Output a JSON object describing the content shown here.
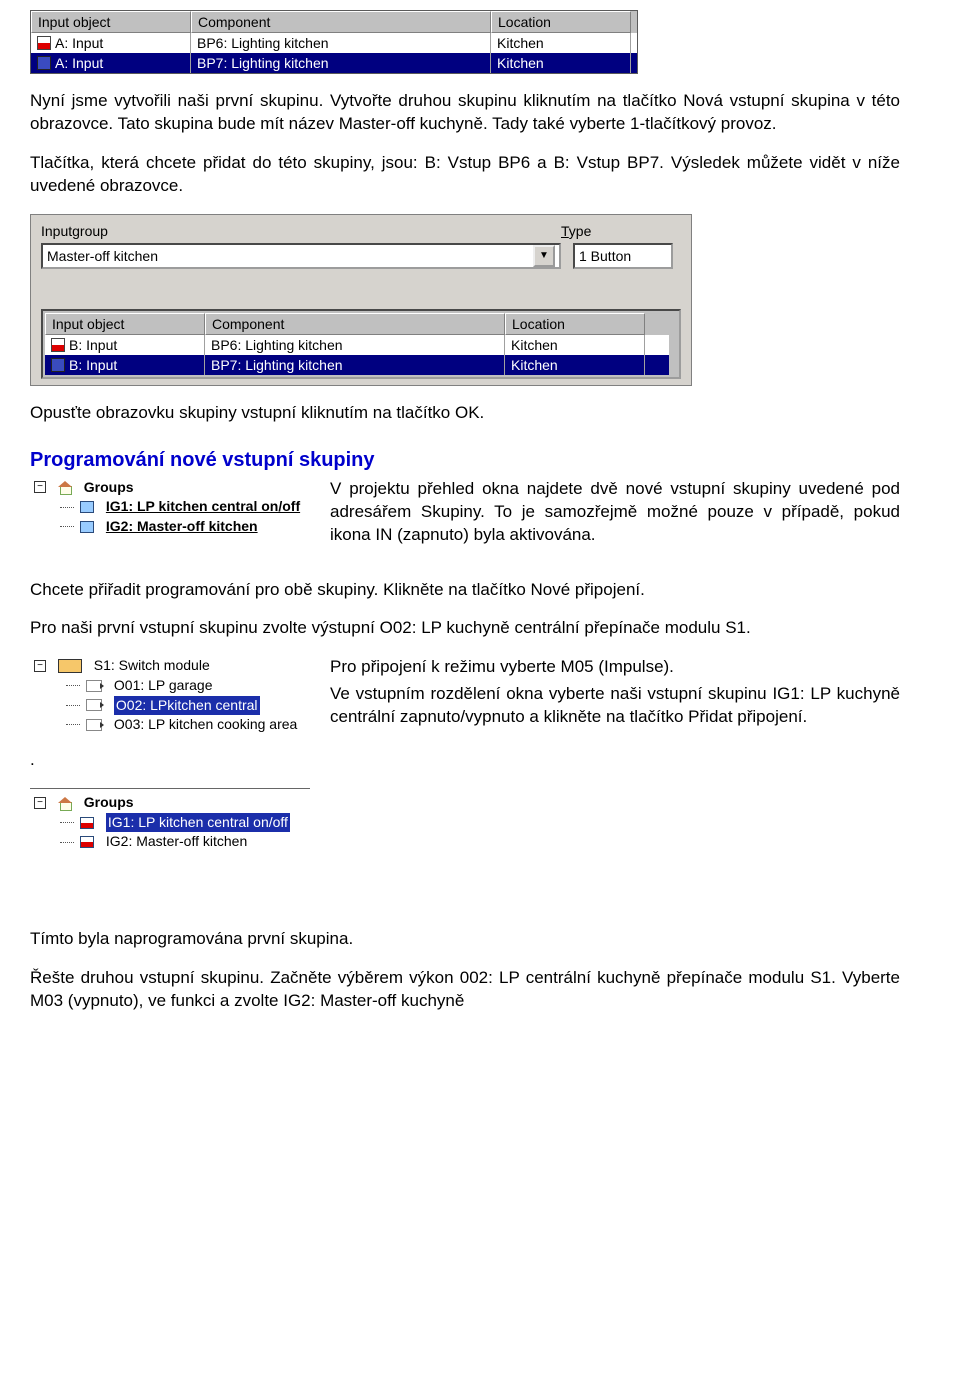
{
  "table1": {
    "headers": [
      "Input object",
      "Component",
      "Location"
    ],
    "rows": [
      {
        "c1": "A: Input",
        "c2": "BP6: Lighting kitchen",
        "c3": "Kitchen",
        "sel": false,
        "icon": "sq-red"
      },
      {
        "c1": "A: Input",
        "c2": "BP7: Lighting kitchen",
        "c3": "Kitchen",
        "sel": true,
        "icon": "sq-blue"
      }
    ]
  },
  "para1": "Nyní jsme vytvořili naši první skupinu. Vytvořte druhou skupinu kliknutím na tlačítko Nová vstupní skupina v této obrazovce. Tato skupina bude mít název Master-off kuchyně. Tady také vyberte 1-tlačítkový provoz.",
  "para2": "Tlačítka, která chcete přidat do této skupiny, jsou: B: Vstup BP6 a B: Vstup BP7.  Výsledek můžete vidět v níže uvedené obrazovce.",
  "panel": {
    "label_input": "Inputgroup",
    "label_type": "Type",
    "label_type_prefix": "T",
    "label_type_suffix": "ype",
    "combo_value": "Master-off kitchen",
    "type_value": "1 Button"
  },
  "table2": {
    "headers": [
      "Input object",
      "Component",
      "Location"
    ],
    "rows": [
      {
        "c1": "B: Input",
        "c2": "BP6: Lighting kitchen",
        "c3": "Kitchen",
        "sel": false,
        "icon": "sq-red"
      },
      {
        "c1": "B: Input",
        "c2": "BP7: Lighting kitchen",
        "c3": "Kitchen",
        "sel": true,
        "icon": "sq-blue"
      }
    ]
  },
  "para3": "Opusťte obrazovku skupiny vstupní kliknutím na tlačítko OK.",
  "section_title": "Programování nové vstupní skupiny",
  "tree1": {
    "root": "Groups",
    "items": [
      "IG1: LP kitchen central on/off",
      "IG2: Master-off kitchen"
    ]
  },
  "para4": "V projektu přehled okna najdete dvě nové vstupní skupiny uvedené pod adresářem Skupiny.  To je samozřejmě možné pouze v případě, pokud ikona IN (zapnuto) byla aktivována.",
  "para5": "Chcete přiřadit programování pro obě skupiny. Klikněte na tlačítko Nové připojení.",
  "para6": "Pro naši první vstupní skupinu zvolte výstupní O02: LP kuchyně centrální přepínače modulu S1.",
  "tree2": {
    "root": "S1: Switch module",
    "items": [
      {
        "label": "O01: LP garage",
        "sel": false
      },
      {
        "label": "O02: LPkitchen central",
        "sel": true
      },
      {
        "label": "O03: LP kitchen cooking area",
        "sel": false
      }
    ]
  },
  "para7": "Pro připojení k režimu vyberte M05 (Impulse).",
  "para8": "Ve vstupním rozdělení okna vyberte naši vstupní skupinu IG1: LP kuchyně centrální zapnuto/vypnuto a klikněte na tlačítko Přidat připojení.",
  "dot": ".",
  "tree3": {
    "root": "Groups",
    "items": [
      {
        "label": "IG1: LP kitchen central on/off",
        "sel": true
      },
      {
        "label": "IG2: Master-off kitchen",
        "sel": false
      }
    ]
  },
  "para9": "Tímto byla naprogramována první skupina.",
  "para10": "Řešte druhou vstupní skupinu.  Začněte výběrem výkon 002: LP centrální kuchyně přepínače modulu S1. Vyberte M03 (vypnuto), ve funkci a zvolte IG2: Master-off kuchyně"
}
